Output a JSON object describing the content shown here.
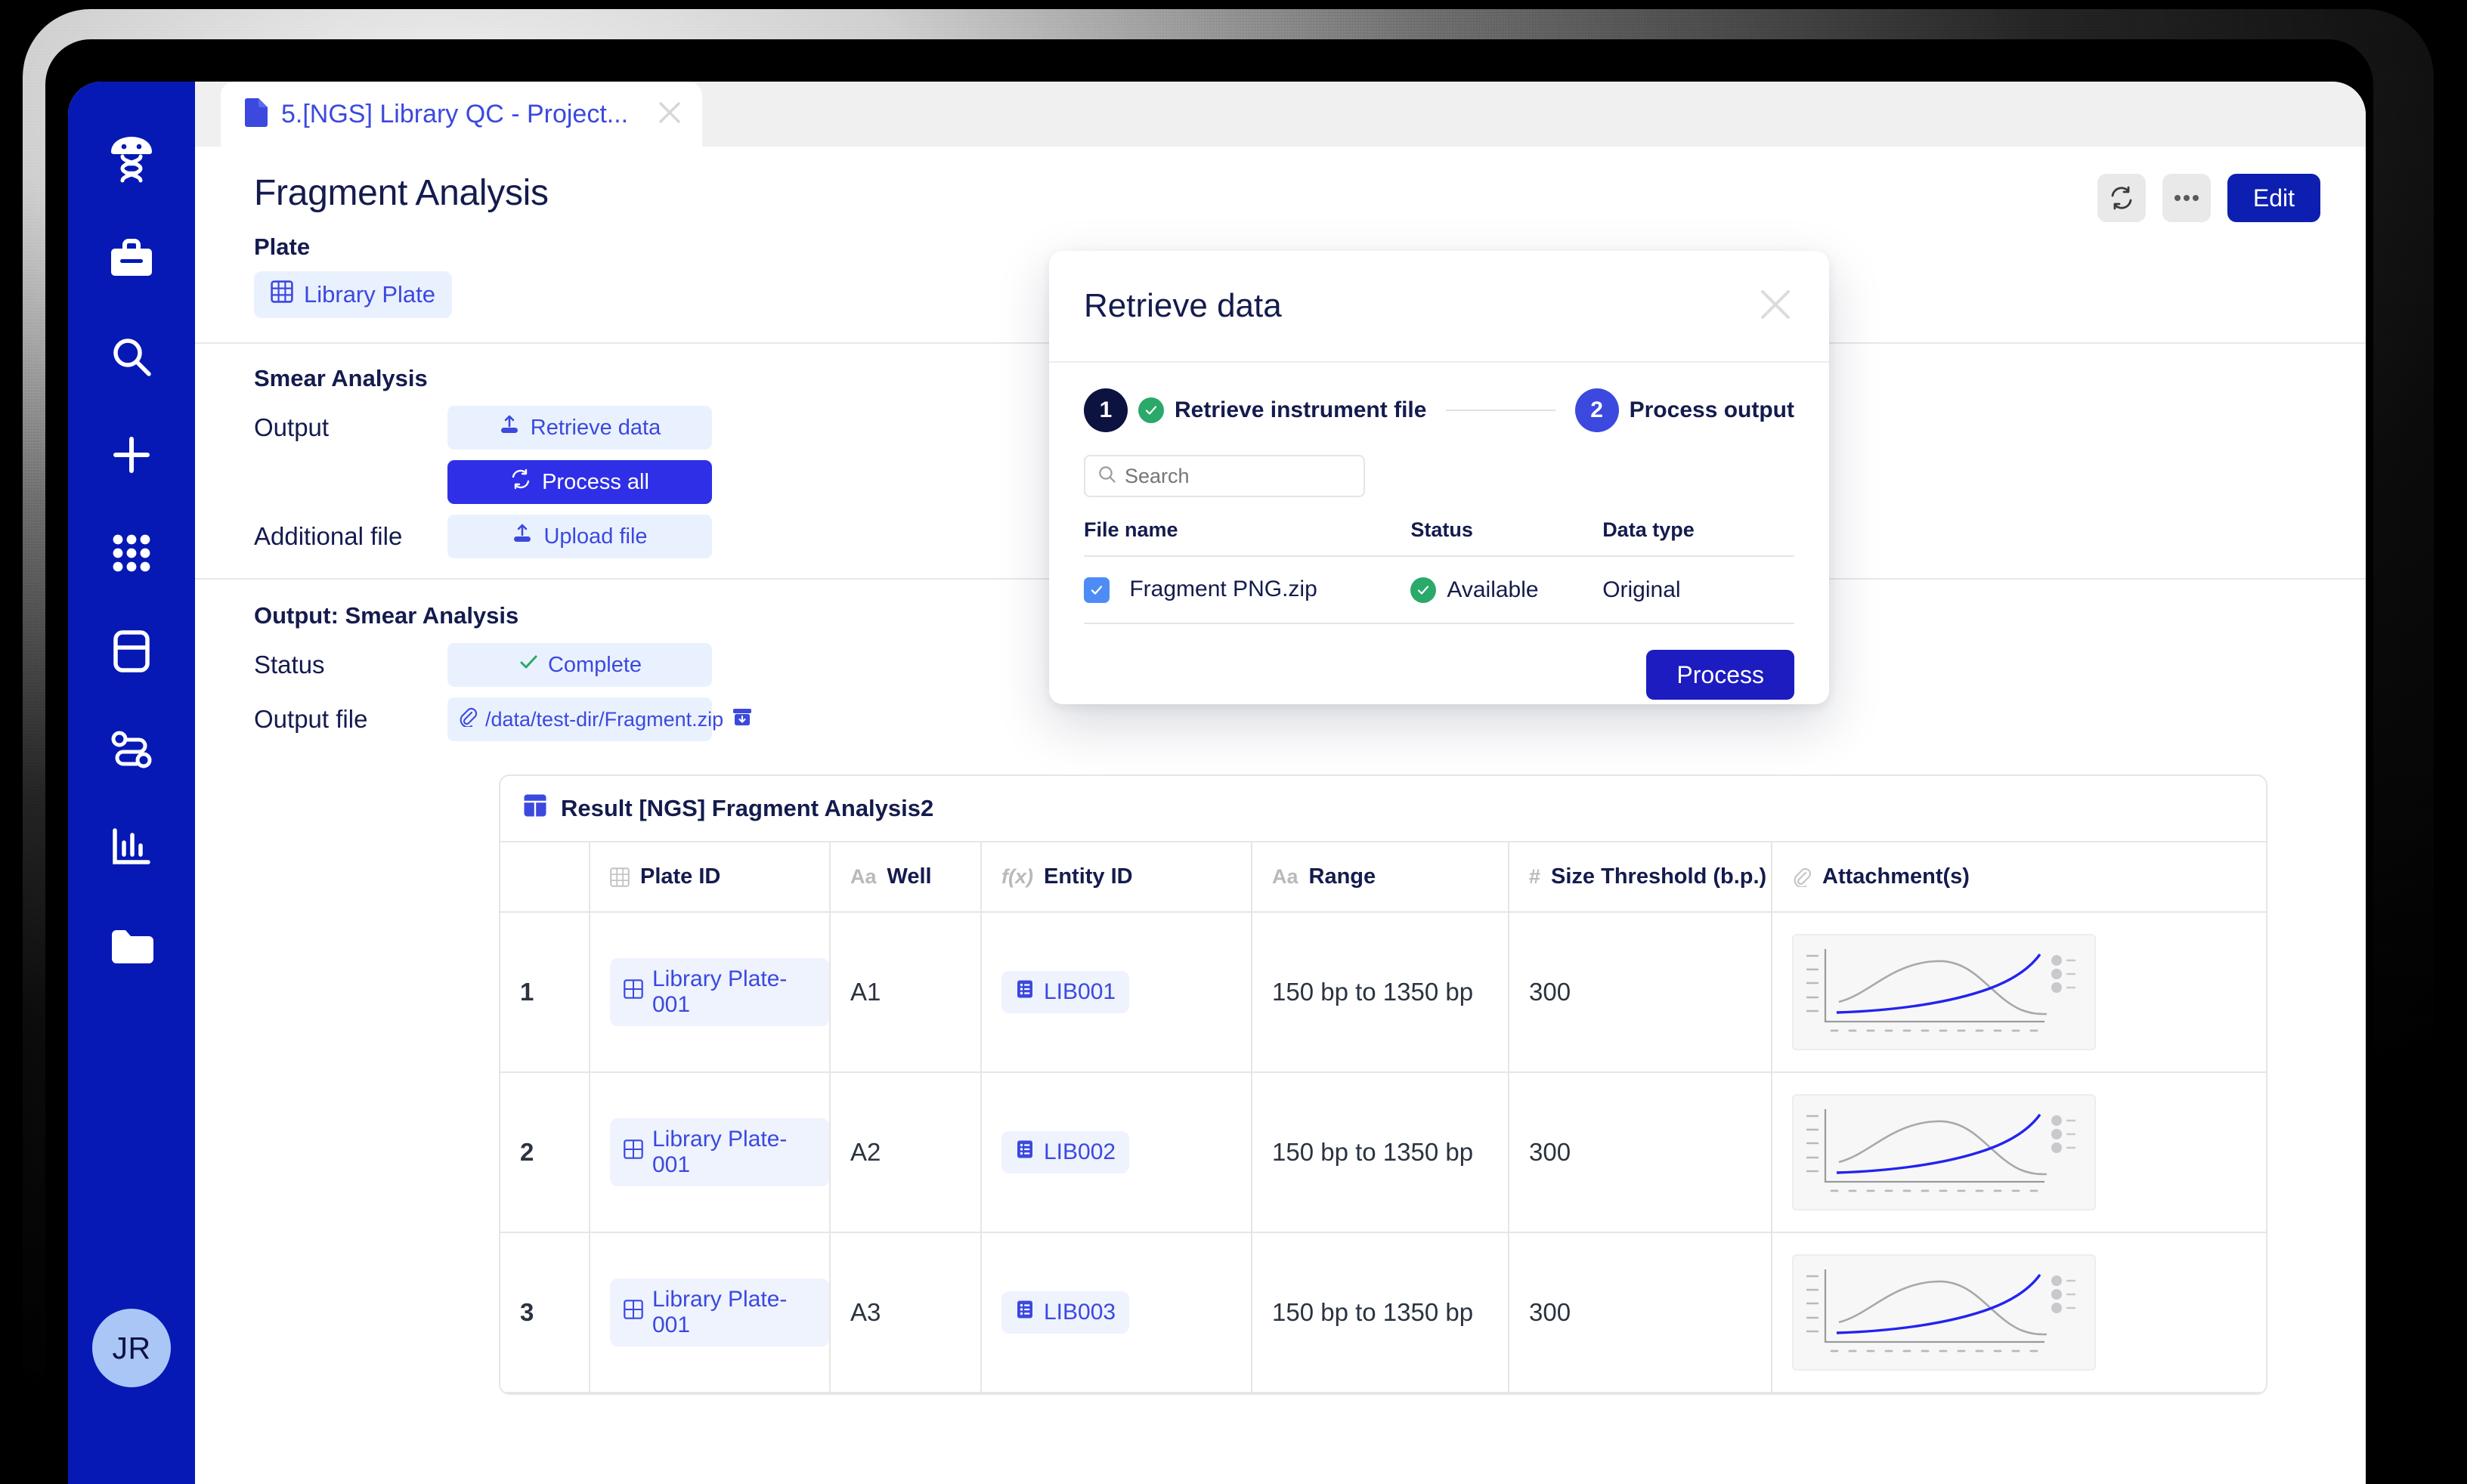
{
  "sidebar": {
    "items": [
      {
        "icon": "dna-person-logo-icon",
        "name": "app-logo"
      },
      {
        "icon": "briefcase-icon",
        "name": "sidebar-item-projects"
      },
      {
        "icon": "search-icon",
        "name": "sidebar-item-search"
      },
      {
        "icon": "plus-icon",
        "name": "sidebar-item-create"
      },
      {
        "icon": "grid-apps-icon",
        "name": "sidebar-item-apps"
      },
      {
        "icon": "database-icon",
        "name": "sidebar-item-inventory"
      },
      {
        "icon": "workflow-icon",
        "name": "sidebar-item-workflows"
      },
      {
        "icon": "bar-chart-icon",
        "name": "sidebar-item-analytics"
      },
      {
        "icon": "folder-icon",
        "name": "sidebar-item-files"
      }
    ],
    "avatar_initials": "JR"
  },
  "tab": {
    "label": "5.[NGS] Library QC - Project...",
    "close_icon": "close-icon",
    "doc_icon": "document-icon"
  },
  "page": {
    "title": "Fragment Analysis",
    "plate_label": "Plate",
    "plate_chip": "Library Plate",
    "smear": {
      "heading": "Smear Analysis",
      "output_key": "Output",
      "retrieve_data_label": "Retrieve data",
      "process_all_label": "Process all",
      "additional_file_key": "Additional file",
      "upload_file_label": "Upload file"
    },
    "output_section": {
      "heading": "Output: Smear Analysis",
      "status_key": "Status",
      "status_value": "Complete",
      "output_file_key": "Output file",
      "output_file_value": "/data/test-dir/Fragment.zip"
    }
  },
  "top_actions": {
    "refresh_icon": "refresh-icon",
    "more_icon": "more-options-icon",
    "edit_label": "Edit"
  },
  "results": {
    "title": "Result [NGS] Fragment Analysis2",
    "table_icon": "table-icon",
    "columns": [
      {
        "label": "",
        "type_icon": ""
      },
      {
        "label": "Plate ID",
        "type_icon": "table-type-icon"
      },
      {
        "label": "Well",
        "type_icon": "Aa"
      },
      {
        "label": "Entity ID",
        "type_icon": "f(x)"
      },
      {
        "label": "Range",
        "type_icon": "Aa"
      },
      {
        "label": "Size Threshold (b.p.)",
        "type_icon": "#"
      },
      {
        "label": "Attachment(s)",
        "type_icon": "paperclip-icon"
      }
    ],
    "rows": [
      {
        "n": "1",
        "plate_id": "Library Plate-001",
        "well": "A1",
        "entity_id": "LIB001",
        "range": "150 bp to 1350 bp",
        "size_threshold": "300",
        "attachment": "chart-thumbnail"
      },
      {
        "n": "2",
        "plate_id": "Library Plate-001",
        "well": "A2",
        "entity_id": "LIB002",
        "range": "150 bp to 1350 bp",
        "size_threshold": "300",
        "attachment": "chart-thumbnail"
      },
      {
        "n": "3",
        "plate_id": "Library Plate-001",
        "well": "A3",
        "entity_id": "LIB003",
        "range": "150 bp to 1350 bp",
        "size_threshold": "300",
        "attachment": "chart-thumbnail"
      }
    ]
  },
  "modal": {
    "title": "Retrieve data",
    "close_icon": "close-icon",
    "steps": [
      {
        "num": "1",
        "label": "Retrieve instrument file",
        "state": "complete"
      },
      {
        "num": "2",
        "label": "Process output",
        "state": "active"
      }
    ],
    "search_placeholder": "Search",
    "search_value": "",
    "columns": [
      "File name",
      "Status",
      "Data type"
    ],
    "rows": [
      {
        "checked": true,
        "file_name": "Fragment PNG.zip",
        "status": "Available",
        "data_type": "Original"
      }
    ],
    "process_label": "Process"
  },
  "colors": {
    "sidebar": "#0619b5",
    "accent": "#3b49df",
    "primary_button": "#1c1cc0",
    "chip_bg": "#eaf1fe",
    "success": "#2aa96a",
    "heading": "#141b4d"
  }
}
